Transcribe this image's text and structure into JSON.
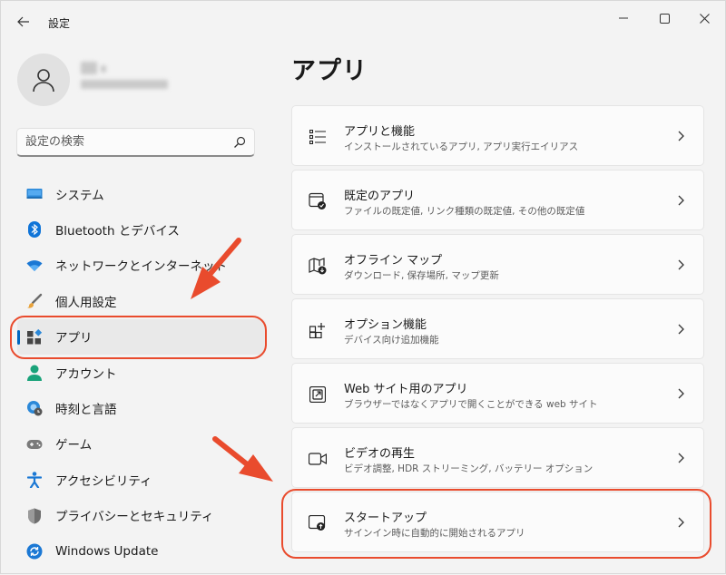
{
  "window": {
    "title": "設定",
    "controls": {
      "minimize": "minimize-icon",
      "maximize": "maximize-icon",
      "close": "close-icon"
    }
  },
  "search": {
    "placeholder": "設定の検索"
  },
  "sidebar": {
    "items": [
      {
        "label": "システム",
        "icon": "system-icon"
      },
      {
        "label": "Bluetooth とデバイス",
        "icon": "bluetooth-icon"
      },
      {
        "label": "ネットワークとインターネット",
        "icon": "wifi-icon"
      },
      {
        "label": "個人用設定",
        "icon": "brush-icon"
      },
      {
        "label": "アプリ",
        "icon": "apps-icon",
        "selected": true
      },
      {
        "label": "アカウント",
        "icon": "account-icon"
      },
      {
        "label": "時刻と言語",
        "icon": "globe-clock-icon"
      },
      {
        "label": "ゲーム",
        "icon": "gamepad-icon"
      },
      {
        "label": "アクセシビリティ",
        "icon": "accessibility-icon"
      },
      {
        "label": "プライバシーとセキュリティ",
        "icon": "shield-icon"
      },
      {
        "label": "Windows Update",
        "icon": "update-icon"
      }
    ]
  },
  "main": {
    "title": "アプリ",
    "cards": [
      {
        "title": "アプリと機能",
        "subtitle": "インストールされているアプリ, アプリ実行エイリアス",
        "icon": "app-list-icon"
      },
      {
        "title": "既定のアプリ",
        "subtitle": "ファイルの既定値, リンク種類の既定値, その他の既定値",
        "icon": "default-apps-icon"
      },
      {
        "title": "オフライン マップ",
        "subtitle": "ダウンロード, 保存場所, マップ更新",
        "icon": "offline-map-icon"
      },
      {
        "title": "オプション機能",
        "subtitle": "デバイス向け追加機能",
        "icon": "optional-features-icon"
      },
      {
        "title": "Web サイト用のアプリ",
        "subtitle": "ブラウザーではなくアプリで開くことができる web サイト",
        "icon": "open-external-icon"
      },
      {
        "title": "ビデオの再生",
        "subtitle": "ビデオ調整, HDR ストリーミング, バッテリー オプション",
        "icon": "video-icon"
      },
      {
        "title": "スタートアップ",
        "subtitle": "サインイン時に自動的に開始されるアプリ",
        "icon": "startup-icon"
      }
    ]
  },
  "colors": {
    "accent": "#0067c0",
    "annotation": "#e94b2d"
  }
}
